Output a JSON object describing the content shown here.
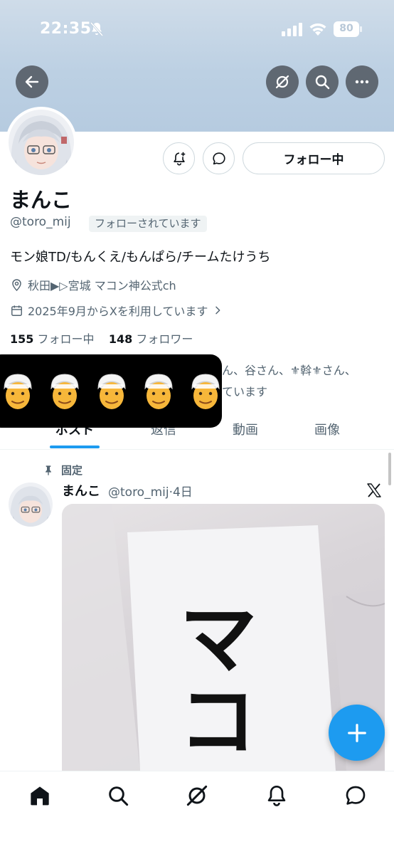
{
  "status_bar": {
    "time": "22:35",
    "battery": "80"
  },
  "profile": {
    "display_name": "まんこ",
    "handle": "@toro_mij",
    "follows_you_badge": "フォローされています",
    "bio": "モン娘TD/もんくえ/もんぱら/チームたけうち",
    "location": "秋田▶▷宮城 マコン神公式ch",
    "joined": "2025年9月からXを利用しています",
    "following_count": "155",
    "following_label": "フォロー中",
    "followers_count": "148",
    "followers_label": "フォロワー",
    "followed_by_line1": "ん、谷さん、⚜斡⚜さん、",
    "followed_by_line2": "ています",
    "follow_button_label": "フォロー中"
  },
  "reaction_overlay": {
    "emoji_count": 5,
    "emoji": "👳"
  },
  "tabs": [
    {
      "label": "ポスト",
      "active": true
    },
    {
      "label": "返信",
      "active": false
    },
    {
      "label": "動画",
      "active": false
    },
    {
      "label": "画像",
      "active": false
    }
  ],
  "pinned_post": {
    "pinned_label": "固定",
    "author": "まんこ",
    "meta": "@toro_mij·4日",
    "image_text": "マコン"
  },
  "icons": {
    "back": "arrow-left-icon",
    "grok": "grok-icon",
    "search": "search-icon",
    "more": "more-icon",
    "notify": "bell-plus-icon",
    "message": "message-icon",
    "compose": "plus-icon"
  },
  "colors": {
    "accent": "#1d9bf0",
    "secondary_text": "#536471",
    "banner": "#bcd0e3"
  }
}
